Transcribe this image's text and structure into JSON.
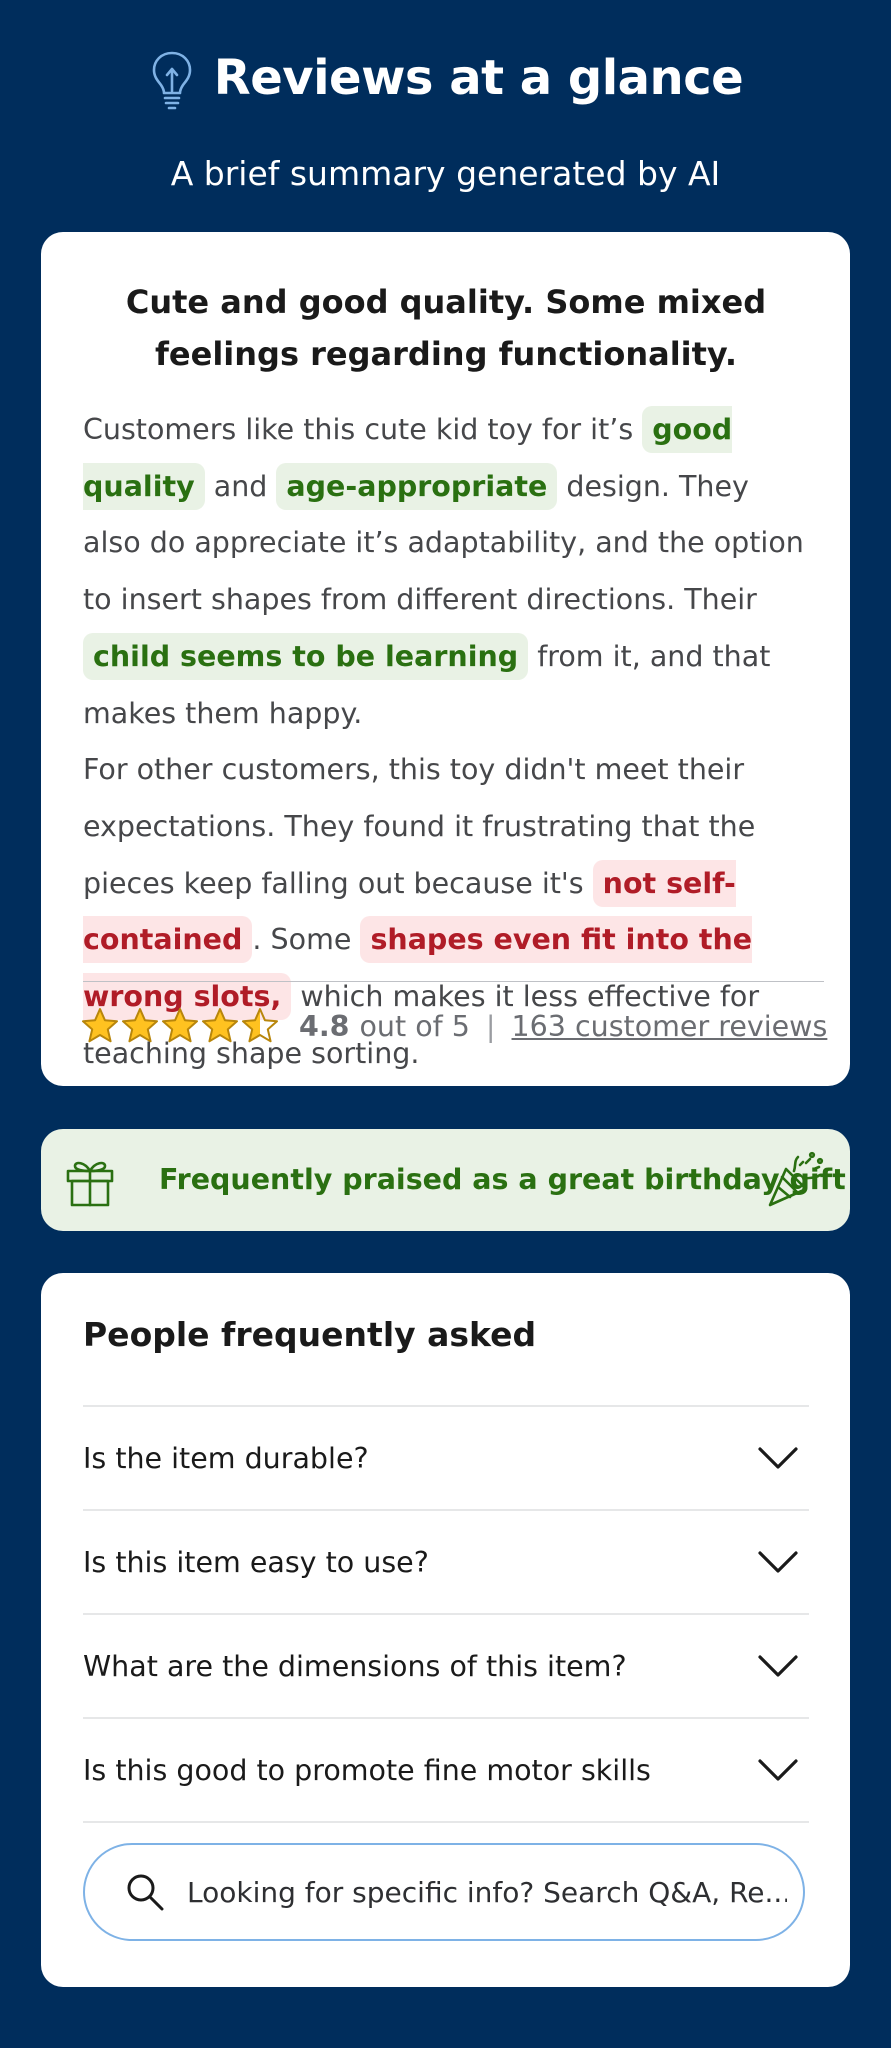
{
  "header": {
    "title": "Reviews at a glance",
    "subtitle": "A brief summary generated by AI",
    "icon": "lightbulb-icon"
  },
  "summary": {
    "headline": "Cute and good quality. Some mixed feelings regarding functionality.",
    "p1": {
      "t1": "Customers like this cute kid toy for it’s ",
      "h1": "good quality",
      "t2": " and ",
      "h2": "age-appropriate",
      "t3": " design. They also do appreciate it’s adaptability, and the option to insert shapes from different directions. Their ",
      "h3": "child seems to be learning",
      "t4": " from it, and that makes them happy."
    },
    "p2": {
      "t1": "For other customers, this toy didn't meet their expectations. They found it frustrating that the pieces keep falling out because it's ",
      "h1": "not self-contained",
      "t2": ". Some ",
      "h2": "shapes even fit into the wrong slots,",
      "t3": " which makes it less effective for teaching shape sorting."
    },
    "highlight_colors": {
      "positive_bg": "#e9f2e5",
      "positive_text": "#2a7011",
      "negative_bg": "#fde5e6",
      "negative_text": "#b01c27"
    }
  },
  "rating": {
    "value": "4.8",
    "stars": 4.8,
    "out_of_label": "out of 5",
    "separator": "|",
    "reviews_link": "163 customer reviews",
    "star_color": "#ffc220"
  },
  "gift_banner": {
    "text": "Frequently praised as a great birthday gift",
    "left_icon": "gift-icon",
    "right_icon": "party-popper-icon"
  },
  "faq": {
    "title": "People frequently asked",
    "questions": [
      "Is the item durable?",
      "Is this item easy to use?",
      "What are the dimensions of this item?",
      "Is this good to promote fine motor skills"
    ],
    "search_placeholder": "Looking for specific info? Search Q&A, Re..."
  },
  "colors": {
    "background": "#002d5c",
    "card": "#ffffff",
    "search_border": "#7eb2e6"
  }
}
